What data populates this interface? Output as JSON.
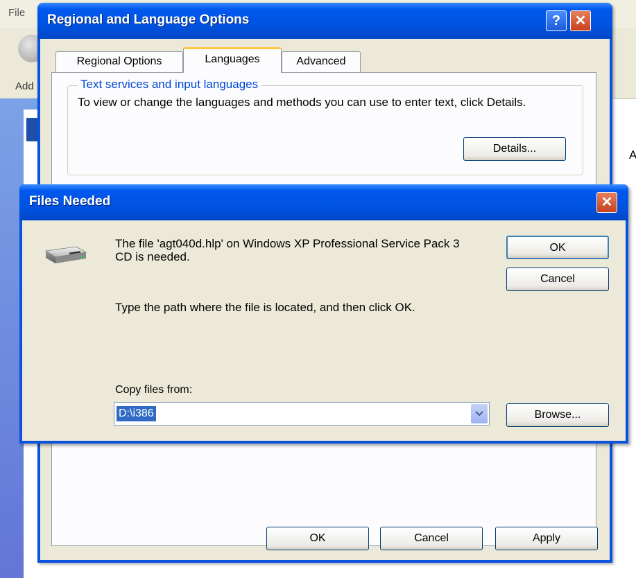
{
  "background": {
    "menu_file": "File",
    "address_label": "Add",
    "right_letter": "A"
  },
  "regional_dialog": {
    "title": "Regional and Language Options",
    "help_glyph": "?",
    "close_glyph": "✕",
    "tabs": [
      {
        "label": "Regional Options"
      },
      {
        "label": "Languages",
        "selected": true
      },
      {
        "label": "Advanced"
      }
    ],
    "group": {
      "legend": "Text services and input languages",
      "description": "To view or change the languages and methods you can use to enter text, click Details.",
      "details_button": "Details..."
    },
    "buttons": {
      "ok": "OK",
      "cancel": "Cancel",
      "apply": "Apply"
    }
  },
  "files_needed_dialog": {
    "title": "Files Needed",
    "close_glyph": "✕",
    "icon": "cd-drive-icon",
    "message": "The file 'agt040d.hlp' on Windows XP Professional Service Pack 3 CD is needed.",
    "prompt": "Type the path where the file is located, and then click OK.",
    "copy_label": "Copy files from:",
    "path_value": "D:\\i386",
    "buttons": {
      "ok": "OK",
      "cancel": "Cancel",
      "browse": "Browse..."
    }
  },
  "colors": {
    "titlebar": "#0053e2",
    "dialog_face": "#ece9d8",
    "group_legend": "#0046d5",
    "selection": "#316ac5"
  }
}
